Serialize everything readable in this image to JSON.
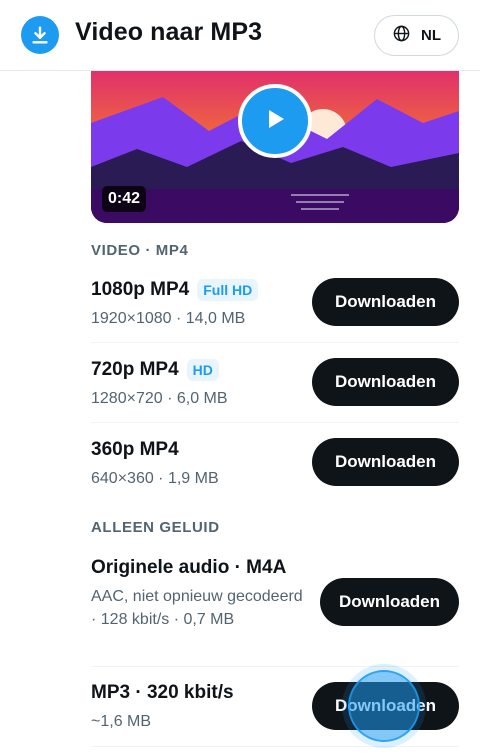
{
  "app": {
    "title": "Video naar MP3",
    "language": "NL"
  },
  "icons": {
    "logo": "download-icon",
    "language": "globe-icon",
    "play": "play-icon"
  },
  "colors": {
    "accent": "#1d9bf0",
    "button": "#0f1419",
    "muted": "#536471"
  },
  "video": {
    "duration": "0:42"
  },
  "sections": {
    "video": "VIDEO · MP4",
    "audio": "ALLEEN GELUID"
  },
  "video_options": [
    {
      "format": "1080p MP4",
      "badge": "Full HD",
      "meta": "1920×1080 · 14,0 MB",
      "button": "Downloaden"
    },
    {
      "format": "720p MP4",
      "badge": "HD",
      "meta": "1280×720 · 6,0 MB",
      "button": "Downloaden"
    },
    {
      "format": "360p MP4",
      "meta": "640×360 · 1,9 MB",
      "button": "Downloaden"
    }
  ],
  "audio_options": [
    {
      "format": "Originele audio · M4A",
      "meta": "AAC, niet opnieuw gecodeerd · 128 kbit/s · 0,7 MB",
      "button": "Downloaden"
    },
    {
      "format": "MP3 · 320 kbit/s",
      "meta": "~1,6 MB",
      "button": "Downloaden"
    }
  ]
}
